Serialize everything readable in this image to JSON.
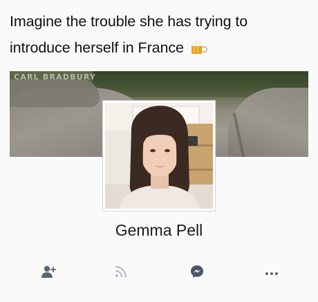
{
  "caption": {
    "text": "Imagine the trouble she has trying to introduce herself in France",
    "emoji": "beer-mug-icon"
  },
  "cover": {
    "watermark": "CARL BRADBURY"
  },
  "profile": {
    "name": "Gemma Pell"
  },
  "actions": [
    {
      "icon": "add-friend-icon"
    },
    {
      "icon": "follow-icon"
    },
    {
      "icon": "messenger-icon"
    },
    {
      "icon": "more-icon"
    }
  ]
}
